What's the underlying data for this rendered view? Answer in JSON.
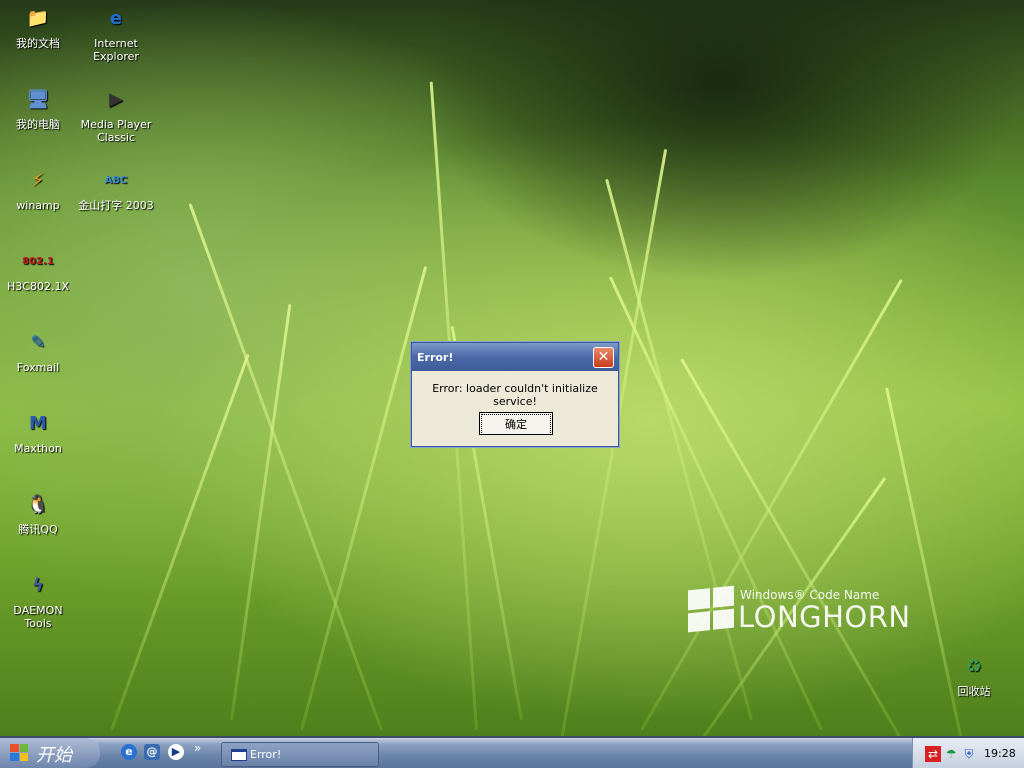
{
  "desktop": {
    "icons": [
      {
        "label": "我的文档",
        "icon": "folder-icon",
        "glyph": "📁"
      },
      {
        "label": "Internet Explorer",
        "icon": "internet-explorer-icon",
        "glyph": "e"
      },
      {
        "label": "我的电脑",
        "icon": "my-computer-icon",
        "glyph": "🖥"
      },
      {
        "label": "Media Player Classic",
        "icon": "media-player-icon",
        "glyph": "▶"
      },
      {
        "label": "winamp",
        "icon": "winamp-icon",
        "glyph": "⚡"
      },
      {
        "label": "金山打字 2003",
        "icon": "typing-icon",
        "glyph": "ABC"
      },
      {
        "label": "H3C802.1X",
        "icon": "h3c-icon",
        "glyph": "802.1"
      },
      {
        "label": "Foxmail",
        "icon": "foxmail-icon",
        "glyph": "✎"
      },
      {
        "label": "Maxthon",
        "icon": "maxthon-icon",
        "glyph": "M"
      },
      {
        "label": "腾讯QQ",
        "icon": "qq-icon",
        "glyph": "🐧"
      },
      {
        "label": "DAEMON Tools",
        "icon": "daemon-tools-icon",
        "glyph": "ϟ"
      },
      {
        "label": "回收站",
        "icon": "recycle-bin-icon",
        "glyph": "♻"
      }
    ],
    "logo": {
      "sub": "Windows® Code Name",
      "main": "LONGHORN"
    }
  },
  "dialog": {
    "title": "Error!",
    "message": "Error: loader couldn't initialize service!",
    "ok": "确定",
    "close": "✕"
  },
  "taskbar": {
    "start": "开始",
    "more": "»",
    "task": "Error!",
    "clock": "19:28"
  },
  "colors": {
    "title": "#4c6aa8",
    "close": "#c83c1c",
    "taskbar": "#6b84aa"
  }
}
